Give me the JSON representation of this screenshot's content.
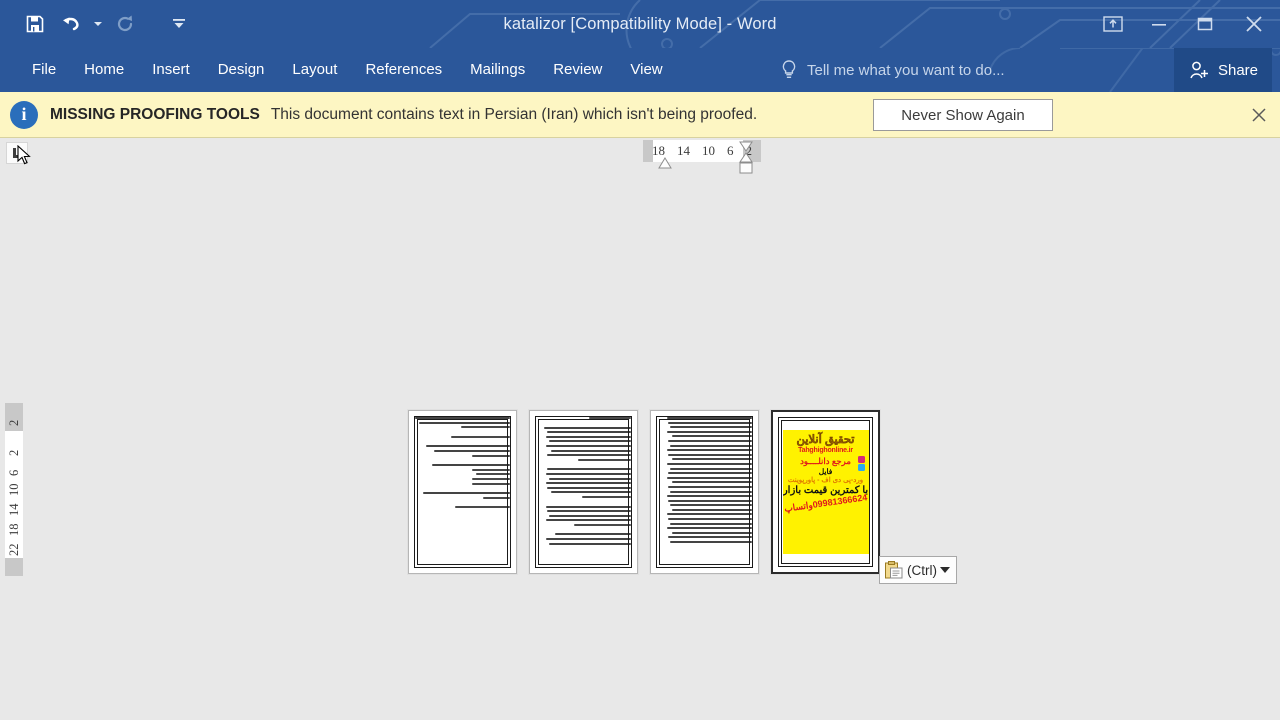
{
  "titlebar": {
    "title": "katalizor [Compatibility Mode] - Word",
    "quick_access": [
      {
        "name": "save",
        "icon": "save-icon",
        "label": "Save",
        "state": "enabled"
      },
      {
        "name": "undo",
        "icon": "undo-icon",
        "label": "Undo",
        "state": "enabled"
      },
      {
        "name": "redo",
        "icon": "redo-icon",
        "label": "Redo",
        "state": "disabled"
      },
      {
        "name": "customize",
        "icon": "customize-quick-access-icon",
        "label": "Customize Quick Access Toolbar",
        "state": "enabled"
      }
    ],
    "window_controls": [
      {
        "name": "ribbon-display-options",
        "icon": "ribbon-display-options-icon",
        "label": "Ribbon Display Options"
      },
      {
        "name": "minimize",
        "icon": "minimize-icon",
        "label": "Minimize"
      },
      {
        "name": "restore",
        "icon": "restore-icon",
        "label": "Restore Down"
      },
      {
        "name": "close",
        "icon": "close-icon",
        "label": "Close"
      }
    ],
    "background_color": "#2b579a"
  },
  "ribbon": {
    "tabs": [
      {
        "label": "File"
      },
      {
        "label": "Home"
      },
      {
        "label": "Insert"
      },
      {
        "label": "Design"
      },
      {
        "label": "Layout"
      },
      {
        "label": "References"
      },
      {
        "label": "Mailings"
      },
      {
        "label": "Review"
      },
      {
        "label": "View"
      }
    ],
    "tell_me": {
      "icon": "lightbulb-icon",
      "placeholder": "Tell me what you want to do..."
    },
    "share": {
      "label": "Share",
      "icon": "share-person-icon",
      "background_color": "#204a87"
    },
    "collapsed": true
  },
  "message_bar": {
    "icon": "info-icon",
    "title": "MISSING PROOFING TOOLS",
    "text": "This document contains text in Persian (Iran) which isn't being proofed.",
    "button_label": "Never Show Again",
    "close_label": "✕",
    "background_color": "#fdf6c3"
  },
  "rulers": {
    "horizontal": {
      "ticks": [
        "18",
        "14",
        "10",
        "6",
        "2"
      ],
      "direction": "rtl",
      "markers": [
        "hanging-indent",
        "first-line-indent",
        "left-indent"
      ]
    },
    "vertical": {
      "ticks": [
        "2",
        "2",
        "6",
        "10",
        "14",
        "18",
        "22"
      ]
    },
    "tab_selector": {
      "name": "tab-stop-selector",
      "glyph": "left-tab"
    }
  },
  "document": {
    "zoom_view": "multiple-pages",
    "pages": [
      {
        "index": 1,
        "selected": false,
        "type": "text",
        "lines": [
          100,
          96,
          52,
          0,
          62,
          0,
          88,
          80,
          40,
          0,
          82,
          40,
          36,
          40,
          40,
          0,
          92,
          28,
          0,
          58
        ]
      },
      {
        "index": 2,
        "selected": false,
        "type": "text",
        "lines": [
          44,
          0,
          92,
          88,
          90,
          86,
          90,
          84,
          88,
          56,
          0,
          88,
          90,
          86,
          90,
          88,
          84,
          52,
          0,
          90,
          88,
          86,
          90,
          60,
          0,
          80,
          90,
          86
        ]
      },
      {
        "index": 3,
        "selected": false,
        "type": "text",
        "lines": [
          90,
          88,
          86,
          90,
          84,
          88,
          86,
          90,
          88,
          84,
          90,
          86,
          88,
          90,
          84,
          88,
          86,
          90,
          88,
          86,
          84,
          90,
          88,
          86,
          90,
          84,
          88,
          86
        ]
      },
      {
        "index": 4,
        "selected": true,
        "type": "image",
        "ad": {
          "title": "تحقیق آنلاین",
          "url": "Tahghighonline.ir",
          "line1": "مرجع دانلــــود",
          "line2": "فایل",
          "line3": "ورد-پی دی اف - پاورپوینت",
          "line4": "با کمترین قیمت بازار",
          "phone": "09981366624واتساپ",
          "background_color": "#fff200"
        }
      }
    ]
  },
  "paste_options": {
    "icon": "clipboard-paste-icon",
    "label": "(Ctrl)",
    "caret": "chevron-down-icon"
  }
}
